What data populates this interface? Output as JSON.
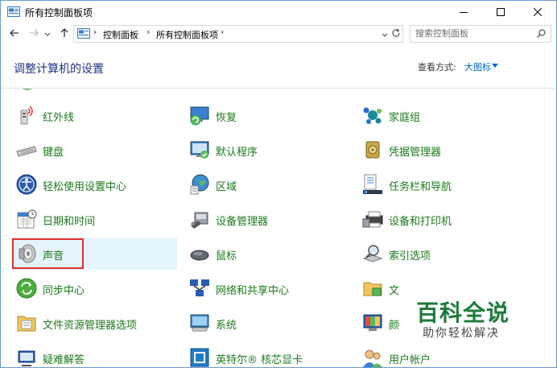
{
  "window": {
    "title": "所有控制面板项",
    "minimize_label": "minimize",
    "maximize_label": "maximize",
    "close_label": "close"
  },
  "address": {
    "crumbs": [
      "控制面板",
      "所有控制面板项"
    ],
    "search_placeholder": "搜索控制面板"
  },
  "header": {
    "title": "调整计算机的设置",
    "view_label": "查看方式:",
    "view_value": "大图标"
  },
  "items": [
    {
      "label": "红外线",
      "icon": "infrared-icon"
    },
    {
      "label": "恢复",
      "icon": "recovery-icon"
    },
    {
      "label": "家庭组",
      "icon": "homegroup-icon"
    },
    {
      "label": "键盘",
      "icon": "keyboard-icon"
    },
    {
      "label": "默认程序",
      "icon": "default-programs-icon"
    },
    {
      "label": "凭据管理器",
      "icon": "credential-manager-icon"
    },
    {
      "label": "轻松使用设置中心",
      "icon": "ease-of-access-icon"
    },
    {
      "label": "区域",
      "icon": "region-icon"
    },
    {
      "label": "任务栏和导航",
      "icon": "taskbar-icon"
    },
    {
      "label": "日期和时间",
      "icon": "date-time-icon"
    },
    {
      "label": "设备管理器",
      "icon": "device-manager-icon"
    },
    {
      "label": "设备和打印机",
      "icon": "devices-printers-icon"
    },
    {
      "label": "声音",
      "icon": "sound-icon"
    },
    {
      "label": "鼠标",
      "icon": "mouse-icon"
    },
    {
      "label": "索引选项",
      "icon": "indexing-options-icon"
    },
    {
      "label": "同步中心",
      "icon": "sync-center-icon"
    },
    {
      "label": "网络和共享中心",
      "icon": "network-sharing-icon"
    },
    {
      "label": "文",
      "icon": "folder-icon"
    },
    {
      "label": "文件资源管理器选项",
      "icon": "file-explorer-options-icon"
    },
    {
      "label": "系统",
      "icon": "system-icon"
    },
    {
      "label": "颜",
      "icon": "color-management-icon"
    },
    {
      "label": "疑难解答",
      "icon": "troubleshooting-icon"
    },
    {
      "label": "英特尔® 核芯显卡",
      "icon": "intel-graphics-icon"
    },
    {
      "label": "用户帐户",
      "icon": "user-accounts-icon"
    }
  ],
  "selected_item": "声音",
  "watermark": {
    "title": "百科全说",
    "subtitle": "助你轻松解决"
  },
  "colors": {
    "link_green": "#1c7a1c",
    "title_blue": "#1e3287",
    "accent_blue": "#0066cc",
    "highlight_red": "#e0302f",
    "watermark_green": "#1d7a3a"
  }
}
